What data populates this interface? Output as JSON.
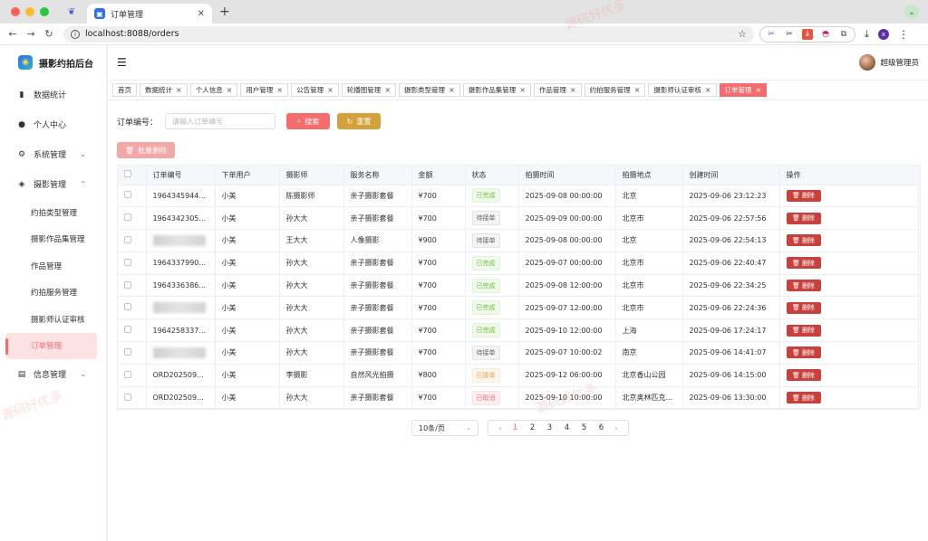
{
  "browser": {
    "tab_title": "订单管理",
    "url": "localhost:8088/orders"
  },
  "app": {
    "brand": "摄影约拍后台",
    "user_name": "超级管理员"
  },
  "sidebar": {
    "items": [
      {
        "label": "数据统计",
        "icon": "bar-chart-icon"
      },
      {
        "label": "个人中心",
        "icon": "user-icon"
      },
      {
        "label": "系统管理",
        "icon": "gear-icon"
      },
      {
        "label": "摄影管理",
        "icon": "aperture-icon"
      }
    ],
    "sub_items": [
      "约拍类型管理",
      "摄影作品集管理",
      "作品管理",
      "约拍服务管理",
      "摄影师认证审核",
      "订单管理"
    ],
    "info_item": "信息管理"
  },
  "tags": [
    "首页",
    "数据统计",
    "个人信息",
    "用户管理",
    "公告管理",
    "轮播图管理",
    "摄影类型管理",
    "摄影作品集管理",
    "作品管理",
    "约拍服务管理",
    "摄影师认证审核",
    "订单管理"
  ],
  "search": {
    "label": "订单编号：",
    "placeholder": "请输入订单编号",
    "search_btn": "搜索",
    "reset_btn": "重置",
    "batch_delete": "批量删除"
  },
  "table": {
    "columns": [
      "订单编号",
      "下单用户",
      "摄影师",
      "服务名称",
      "金额",
      "状态",
      "拍摄时间",
      "拍摄地点",
      "创建时间",
      "操作"
    ],
    "delete_label": "删除",
    "rows": [
      {
        "order_no": "1964345944...",
        "user": "小美",
        "photographer": "陈摄影师",
        "service": "亲子摄影套餐",
        "amount": "¥700",
        "status": "已完成",
        "status_kind": "done",
        "shoot_time": "2025-09-08 00:00:00",
        "location": "北京",
        "created": "2025-09-06 23:12:23"
      },
      {
        "order_no": "1964342305...",
        "user": "小美",
        "photographer": "孙大大",
        "service": "亲子摄影套餐",
        "amount": "¥700",
        "status": "待接单",
        "status_kind": "wait",
        "shoot_time": "2025-09-09 00:00:00",
        "location": "北京市",
        "created": "2025-09-06 22:57:56"
      },
      {
        "order_no": "",
        "user": "小美",
        "photographer": "王大大",
        "service": "人像摄影",
        "amount": "¥900",
        "status": "待接单",
        "status_kind": "wait",
        "shoot_time": "2025-09-08 00:00:00",
        "location": "北京",
        "created": "2025-09-06 22:54:13"
      },
      {
        "order_no": "1964337990...",
        "user": "小美",
        "photographer": "孙大大",
        "service": "亲子摄影套餐",
        "amount": "¥700",
        "status": "已完成",
        "status_kind": "done",
        "shoot_time": "2025-09-07 00:00:00",
        "location": "北京市",
        "created": "2025-09-06 22:40:47"
      },
      {
        "order_no": "1964336386...",
        "user": "小美",
        "photographer": "孙大大",
        "service": "亲子摄影套餐",
        "amount": "¥700",
        "status": "已完成",
        "status_kind": "done",
        "shoot_time": "2025-09-08 12:00:00",
        "location": "北京市",
        "created": "2025-09-06 22:34:25"
      },
      {
        "order_no": "",
        "user": "小美",
        "photographer": "孙大大",
        "service": "亲子摄影套餐",
        "amount": "¥700",
        "status": "已完成",
        "status_kind": "done",
        "shoot_time": "2025-09-07 12:00:00",
        "location": "北京市",
        "created": "2025-09-06 22:24:36"
      },
      {
        "order_no": "1964258337...",
        "user": "小美",
        "photographer": "孙大大",
        "service": "亲子摄影套餐",
        "amount": "¥700",
        "status": "已完成",
        "status_kind": "done",
        "shoot_time": "2025-09-10 12:00:00",
        "location": "上海",
        "created": "2025-09-06 17:24:17"
      },
      {
        "order_no": "",
        "user": "小美",
        "photographer": "孙大大",
        "service": "亲子摄影套餐",
        "amount": "¥700",
        "status": "待接单",
        "status_kind": "wait",
        "shoot_time": "2025-09-07 10:00:02",
        "location": "南京",
        "created": "2025-09-06 14:41:07"
      },
      {
        "order_no": "ORD202509...",
        "user": "小美",
        "photographer": "李摄影",
        "service": "自然风光拍摄",
        "amount": "¥800",
        "status": "已接单",
        "status_kind": "acc",
        "shoot_time": "2025-09-12 06:00:00",
        "location": "北京香山公园",
        "created": "2025-09-06 14:15:00"
      },
      {
        "order_no": "ORD202509...",
        "user": "小美",
        "photographer": "孙大大",
        "service": "亲子摄影套餐",
        "amount": "¥700",
        "status": "已取消",
        "status_kind": "cancel",
        "shoot_time": "2025-09-10 10:00:00",
        "location": "北京奥林匹克...",
        "created": "2025-09-06 13:30:00"
      }
    ]
  },
  "pagination": {
    "page_size": "10条/页",
    "pages": [
      "1",
      "2",
      "3",
      "4",
      "5",
      "6"
    ],
    "current": "1"
  },
  "watermark_text": "源码好优多"
}
